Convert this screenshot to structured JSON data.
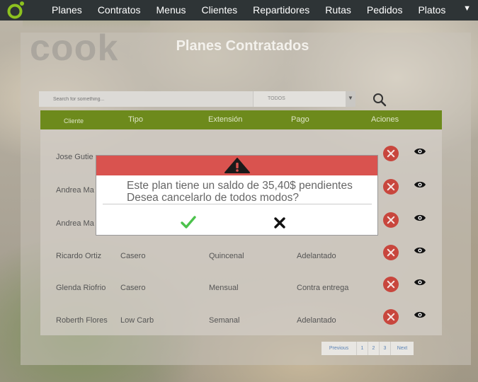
{
  "nav": {
    "items": [
      "Planes",
      "Contratos",
      "Menus",
      "Clientes",
      "Repartidores",
      "Rutas",
      "Pedidos",
      "Platos"
    ],
    "caret": "▼"
  },
  "brand": {
    "ghost_text": "cook"
  },
  "page": {
    "title": "Planes Contratados"
  },
  "search": {
    "placeholder": "Search for something..."
  },
  "filter": {
    "selected": "TODOS"
  },
  "table": {
    "headers": {
      "cliente": "Cliente",
      "tipo": "Tipo",
      "extension": "Extensión",
      "pago": "Pago",
      "acciones": "Aciones"
    },
    "rows": [
      {
        "cliente": "Jose Gutie",
        "tipo": "",
        "extension": "",
        "pago": ""
      },
      {
        "cliente": "Andrea Ma",
        "tipo": "",
        "extension": "",
        "pago": ""
      },
      {
        "cliente": "Andrea Ma",
        "tipo": "",
        "extension": "",
        "pago": ""
      },
      {
        "cliente": "Ricardo Ortiz",
        "tipo": "Casero",
        "extension": "Quincenal",
        "pago": "Adelantado"
      },
      {
        "cliente": "Glenda Riofrio",
        "tipo": "Casero",
        "extension": "Mensual",
        "pago": "Contra entrega"
      },
      {
        "cliente": "Roberth Flores",
        "tipo": "Low Carb",
        "extension": "Semanal",
        "pago": "Adelantado"
      }
    ]
  },
  "pagination": {
    "previous": "Previous",
    "pages": [
      "1",
      "2",
      "3"
    ],
    "next": "Next"
  },
  "modal": {
    "line1": "Este plan tiene un saldo de 35,40$ pendientes",
    "line2": "Desea cancelarlo de todos modos?"
  },
  "colors": {
    "navbar": "#2e3436",
    "logo_accent": "#8dc21f",
    "table_header": "#6d8a1c",
    "modal_header": "#d9534f",
    "delete_button": "#c8463d",
    "confirm_check": "#4cc24c"
  },
  "icons": {
    "logo": "logo-mark-icon",
    "search": "search-icon",
    "delete": "delete-circle-x-icon",
    "view": "eye-icon",
    "warning": "warning-triangle-icon",
    "confirm": "check-icon",
    "cancel": "close-x-icon"
  }
}
